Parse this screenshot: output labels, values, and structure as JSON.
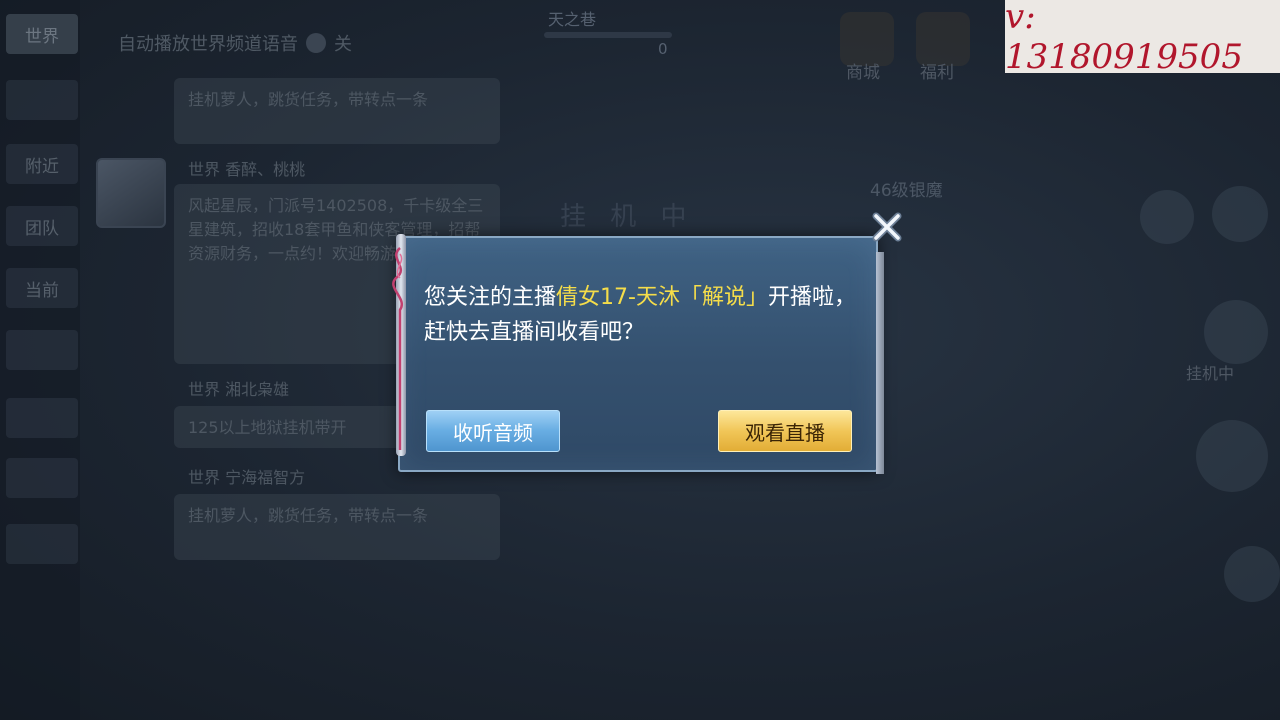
{
  "background": {
    "tabs": [
      "世界",
      "",
      "附近",
      "团队",
      "当前",
      "",
      "",
      "",
      ""
    ],
    "auto_voice_label": "自动播放世界频道语音",
    "auto_voice_state": "关",
    "chat": [
      {
        "name": "",
        "text": "挂机萝人，跳货任务，带转点一条"
      },
      {
        "name": "世界  香醉、桃桃",
        "text": "风起星辰，门派号1402508，千卡级全三星建筑，招收18套甲鱼和侠客管理，招帮资源财务，一点约！欢迎畅游探索入"
      },
      {
        "name": "世界  湘北枭雄",
        "text": "125以上地狱挂机带开"
      },
      {
        "name": "世界  宁海福智方",
        "text": "挂机萝人，跳货任务，带转点一条"
      }
    ],
    "map_name": "天之巷",
    "map_value": "0",
    "status_text": "挂 机 中",
    "level_text": "46级银魔",
    "top_icons": [
      "商城",
      "福利"
    ],
    "side_label": "挂机中"
  },
  "watermark": {
    "text": "v:  13180919505"
  },
  "dialog": {
    "message_prefix": "您关注的主播",
    "streamer_name": "倩女17-天沐「解说」",
    "message_suffix": "开播啦，赶快去直播间收看吧？",
    "audio_button_label": "收听音频",
    "live_button_label": "观看直播",
    "highlight_color": "#f5dd4a"
  }
}
